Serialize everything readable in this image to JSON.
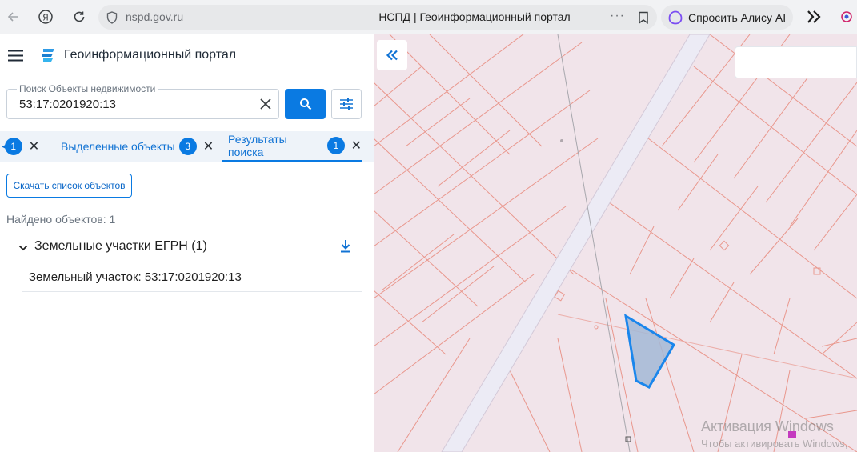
{
  "browser": {
    "url": "nspd.gov.ru",
    "tab_title": "НСПД | Геоинформационный портал",
    "more": "···",
    "alice_label": "Спросить Алису AI"
  },
  "app": {
    "title": "Геоинформационный портал"
  },
  "search": {
    "label": "Поиск Объекты недвижимости",
    "value": "53:17:0201920:13"
  },
  "tabs": [
    {
      "label": "",
      "count": "1"
    },
    {
      "label": "Выделенные объекты",
      "count": "3"
    },
    {
      "label": "Результаты поиска",
      "count": "1"
    }
  ],
  "results": {
    "download_list_label": "Скачать список объектов",
    "found_text": "Найдено объектов: 1",
    "group_label": "Земельные участки ЕГРН (1)",
    "item_label": "Земельный участок: 53:17:0201920:13"
  },
  "watermark": {
    "title": "Активация Windows",
    "subtitle": "Чтобы активировать Windows,"
  },
  "colors": {
    "accent": "#0a7ae2",
    "map_bg": "#f1e4ea",
    "parcel_line": "#e9978d",
    "road": "#ecebf5",
    "selected_fill": "#a3b9d6",
    "selected_stroke": "#1a86ec"
  },
  "icons": [
    "back-arrow-icon",
    "yandex-icon",
    "reload-icon",
    "shield-icon",
    "bookmark-icon",
    "alice-icon",
    "menu-icon",
    "logo-icon",
    "close-icon",
    "search-icon",
    "filter-icon",
    "download-icon",
    "chevron-down-icon",
    "double-chevron-left-icon"
  ]
}
